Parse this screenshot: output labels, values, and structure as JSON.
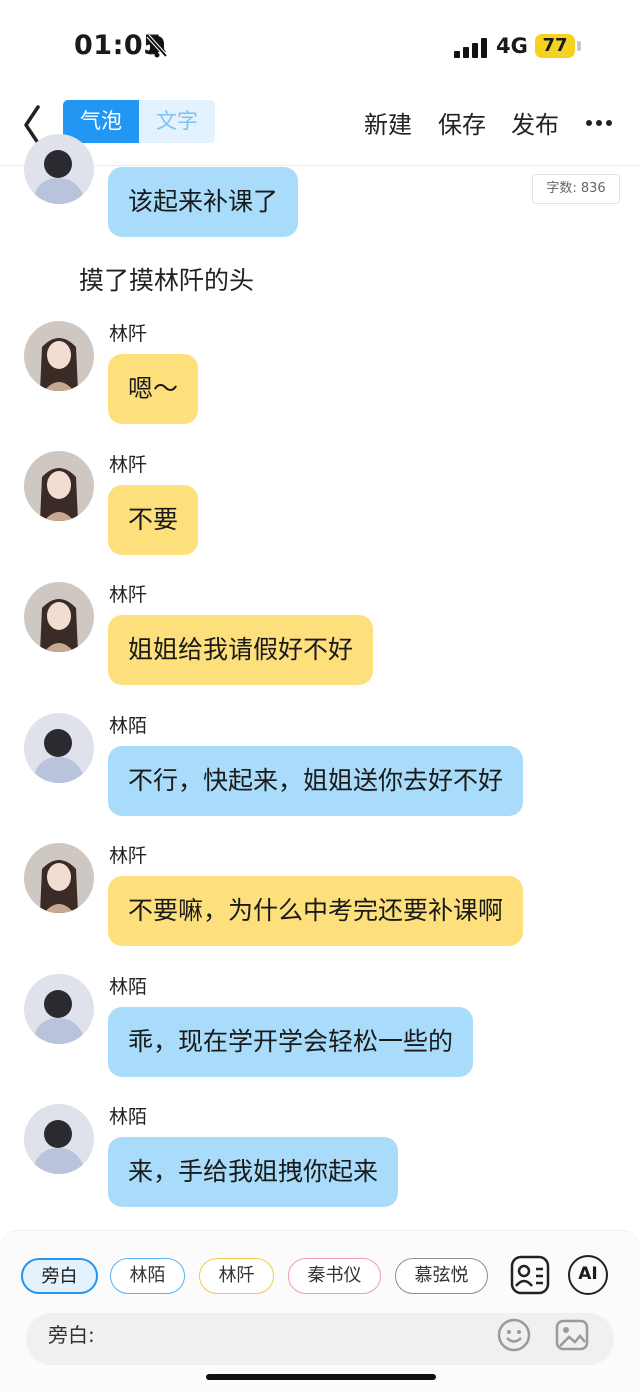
{
  "status_bar": {
    "time": "01:05",
    "network": "4G",
    "battery": "77"
  },
  "nav": {
    "tab_bubble": "气泡",
    "tab_text": "文字",
    "new_label": "新建",
    "save_label": "保存",
    "publish_label": "发布"
  },
  "word_count": "字数: 836",
  "messages": [
    {
      "speaker": "",
      "text": "该起来补课了",
      "color": "blue"
    },
    {
      "narration": "摸了摸林阡的头"
    },
    {
      "speaker": "林阡",
      "text": "嗯～",
      "color": "yellow"
    },
    {
      "speaker": "林阡",
      "text": "不要",
      "color": "yellow"
    },
    {
      "speaker": "林阡",
      "text": "姐姐给我请假好不好",
      "color": "yellow"
    },
    {
      "speaker": "林陌",
      "text": "不行，快起来，姐姐送你去好不好",
      "color": "blue"
    },
    {
      "speaker": "林阡",
      "text": "不要嘛，为什么中考完还要补课啊",
      "color": "yellow"
    },
    {
      "speaker": "林陌",
      "text": "乖，现在学开学会轻松一些的",
      "color": "blue"
    },
    {
      "speaker": "林陌",
      "text": "来，手给我姐拽你起来",
      "color": "blue"
    }
  ],
  "roles": [
    "旁白",
    "林陌",
    "林阡",
    "秦书仪",
    "慕弦悦"
  ],
  "ai_label": "AI",
  "input": {
    "label": "旁白:"
  },
  "colors": {
    "accent": "#2196f3",
    "bubble_yellow": "#fde07c",
    "bubble_blue": "#a8dcfa"
  }
}
